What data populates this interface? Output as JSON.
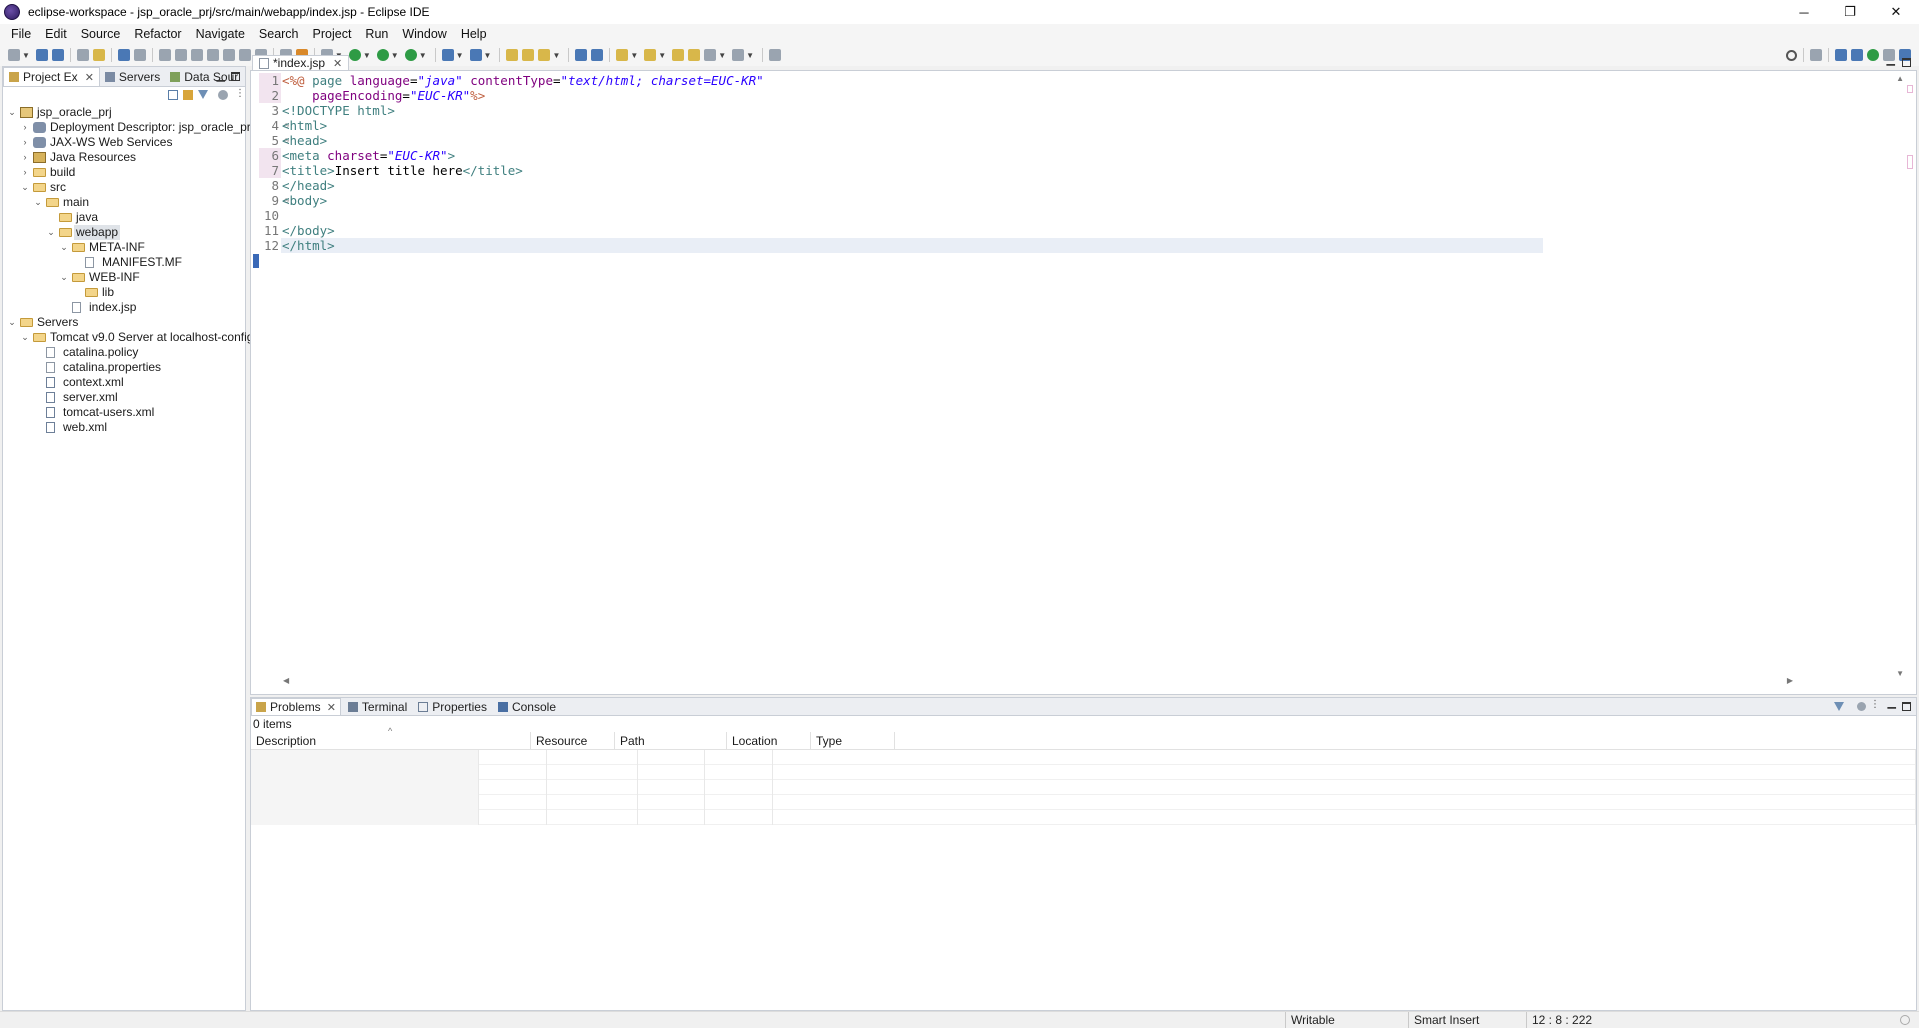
{
  "window": {
    "title": "eclipse-workspace - jsp_oracle_prj/src/main/webapp/index.jsp - Eclipse IDE",
    "minimize": "─",
    "restore": "❐",
    "close": "✕"
  },
  "menubar": [
    "File",
    "Edit",
    "Source",
    "Refactor",
    "Navigate",
    "Search",
    "Project",
    "Run",
    "Window",
    "Help"
  ],
  "left_panel": {
    "tabs": [
      {
        "label": "Project Ex",
        "icon": "project-explorer-icon",
        "active": true
      },
      {
        "label": "Servers",
        "icon": "servers-icon",
        "active": false
      },
      {
        "label": "Data Sour",
        "icon": "data-source-icon",
        "active": false
      }
    ],
    "tree": [
      {
        "label": "jsp_oracle_prj",
        "depth": 0,
        "twisty": "⌄",
        "icon": "project"
      },
      {
        "label": "Deployment Descriptor: jsp_oracle_prj",
        "depth": 1,
        "twisty": "›",
        "icon": "gear"
      },
      {
        "label": "JAX-WS Web Services",
        "depth": 1,
        "twisty": "›",
        "icon": "gear"
      },
      {
        "label": "Java Resources",
        "depth": 1,
        "twisty": "›",
        "icon": "jres"
      },
      {
        "label": "build",
        "depth": 1,
        "twisty": "›",
        "icon": "folder"
      },
      {
        "label": "src",
        "depth": 1,
        "twisty": "⌄",
        "icon": "folder"
      },
      {
        "label": "main",
        "depth": 2,
        "twisty": "⌄",
        "icon": "folder"
      },
      {
        "label": "java",
        "depth": 3,
        "twisty": "",
        "icon": "folder"
      },
      {
        "label": "webapp",
        "depth": 3,
        "twisty": "⌄",
        "icon": "folder",
        "selected": true
      },
      {
        "label": "META-INF",
        "depth": 4,
        "twisty": "⌄",
        "icon": "folder"
      },
      {
        "label": "MANIFEST.MF",
        "depth": 5,
        "twisty": "",
        "icon": "file"
      },
      {
        "label": "WEB-INF",
        "depth": 4,
        "twisty": "⌄",
        "icon": "folder"
      },
      {
        "label": "lib",
        "depth": 5,
        "twisty": "",
        "icon": "folder"
      },
      {
        "label": "index.jsp",
        "depth": 4,
        "twisty": "",
        "icon": "file"
      },
      {
        "label": "Servers",
        "depth": 0,
        "twisty": "⌄",
        "icon": "folder"
      },
      {
        "label": "Tomcat v9.0 Server at localhost-config",
        "depth": 1,
        "twisty": "⌄",
        "icon": "folder"
      },
      {
        "label": "catalina.policy",
        "depth": 2,
        "twisty": "",
        "icon": "file"
      },
      {
        "label": "catalina.properties",
        "depth": 2,
        "twisty": "",
        "icon": "file"
      },
      {
        "label": "context.xml",
        "depth": 2,
        "twisty": "",
        "icon": "xml"
      },
      {
        "label": "server.xml",
        "depth": 2,
        "twisty": "",
        "icon": "xml"
      },
      {
        "label": "tomcat-users.xml",
        "depth": 2,
        "twisty": "",
        "icon": "xml"
      },
      {
        "label": "web.xml",
        "depth": 2,
        "twisty": "",
        "icon": "xml"
      }
    ]
  },
  "editor": {
    "tab_label": "*index.jsp",
    "lines": [
      {
        "n": "1",
        "mark": true,
        "fold": "",
        "current": false,
        "tokens": [
          [
            "jsp",
            "<%@ "
          ],
          [
            "tag",
            "page "
          ],
          [
            "attr",
            "language"
          ],
          [
            "txt",
            "="
          ],
          [
            "val",
            "\"java\""
          ],
          [
            "txt",
            " "
          ],
          [
            "attr",
            "contentType"
          ],
          [
            "txt",
            "="
          ],
          [
            "val",
            "\"text/html; charset=EUC-KR\""
          ]
        ]
      },
      {
        "n": "2",
        "mark": true,
        "fold": "",
        "current": false,
        "tokens": [
          [
            "txt",
            "    "
          ],
          [
            "attr",
            "pageEncoding"
          ],
          [
            "txt",
            "="
          ],
          [
            "val",
            "\"EUC-KR\""
          ],
          [
            "jsp",
            "%>"
          ]
        ]
      },
      {
        "n": "3",
        "mark": false,
        "fold": "",
        "current": false,
        "tokens": [
          [
            "tag",
            "<!DOCTYPE html>"
          ]
        ]
      },
      {
        "n": "4",
        "mark": false,
        "fold": "⊖",
        "current": false,
        "tokens": [
          [
            "tag",
            "<html>"
          ]
        ]
      },
      {
        "n": "5",
        "mark": false,
        "fold": "⊖",
        "current": false,
        "tokens": [
          [
            "tag",
            "<head>"
          ]
        ]
      },
      {
        "n": "6",
        "mark": true,
        "fold": "",
        "current": false,
        "tokens": [
          [
            "tag",
            "<meta "
          ],
          [
            "attr",
            "charset"
          ],
          [
            "txt",
            "="
          ],
          [
            "val",
            "\"EUC-KR\""
          ],
          [
            "tag",
            ">"
          ]
        ]
      },
      {
        "n": "7",
        "mark": true,
        "fold": "",
        "current": false,
        "tokens": [
          [
            "tag",
            "<title>"
          ],
          [
            "txt",
            "Insert title here"
          ],
          [
            "tag",
            "</title>"
          ]
        ]
      },
      {
        "n": "8",
        "mark": false,
        "fold": "",
        "current": false,
        "tokens": [
          [
            "tag",
            "</head>"
          ]
        ]
      },
      {
        "n": "9",
        "mark": false,
        "fold": "⊖",
        "current": false,
        "tokens": [
          [
            "tag",
            "<body>"
          ]
        ]
      },
      {
        "n": "10",
        "mark": false,
        "fold": "",
        "current": false,
        "tokens": [
          [
            "txt",
            ""
          ]
        ]
      },
      {
        "n": "11",
        "mark": false,
        "fold": "",
        "current": false,
        "tokens": [
          [
            "tag",
            "</body>"
          ]
        ]
      },
      {
        "n": "12",
        "mark": false,
        "fold": "",
        "current": true,
        "tokens": [
          [
            "tag",
            "</html>"
          ]
        ]
      }
    ]
  },
  "bottom_panel": {
    "tabs": [
      {
        "label": "Problems",
        "icon": "problems-icon",
        "active": true
      },
      {
        "label": "Terminal",
        "icon": "terminal-icon",
        "active": false
      },
      {
        "label": "Properties",
        "icon": "properties-icon",
        "active": false
      },
      {
        "label": "Console",
        "icon": "console-icon",
        "active": false
      }
    ],
    "items_count": "0 items",
    "columns": [
      "Description",
      "Resource",
      "Path",
      "Location",
      "Type"
    ]
  },
  "statusbar": {
    "mode": "Writable",
    "insert": "Smart Insert",
    "position": "12 : 8 : 222"
  }
}
